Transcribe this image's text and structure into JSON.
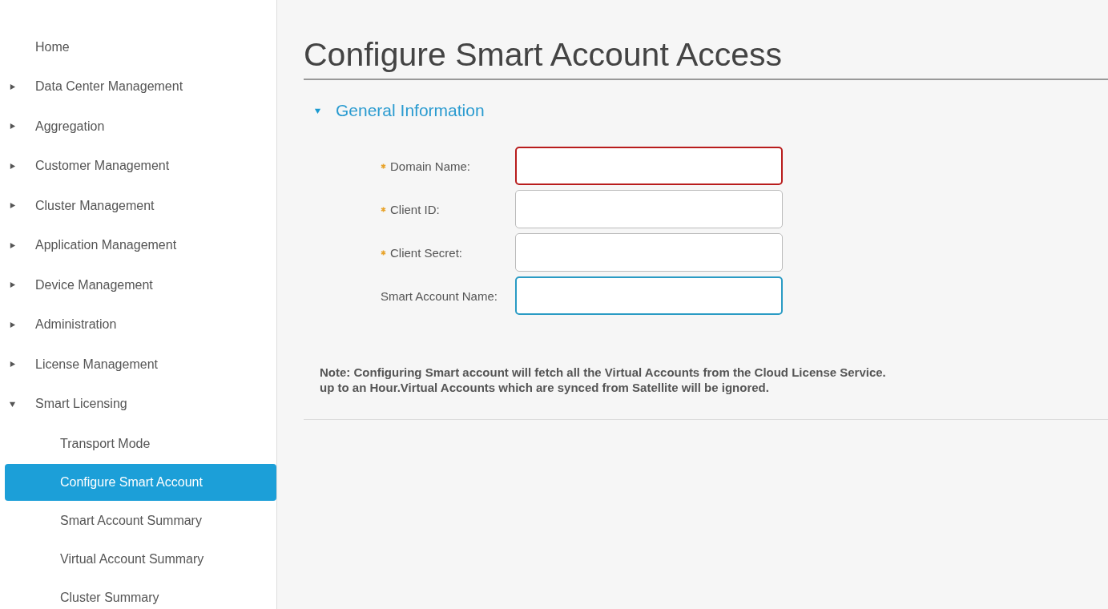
{
  "sidebar": {
    "items": [
      {
        "label": "Home"
      },
      {
        "label": "Data Center Management",
        "expanded": false
      },
      {
        "label": "Aggregation",
        "expanded": false
      },
      {
        "label": "Customer Management",
        "expanded": false
      },
      {
        "label": "Cluster Management",
        "expanded": false
      },
      {
        "label": "Application Management",
        "expanded": false
      },
      {
        "label": "Device Management",
        "expanded": false
      },
      {
        "label": "Administration",
        "expanded": false
      },
      {
        "label": "License Management",
        "expanded": false
      },
      {
        "label": "Smart Licensing",
        "expanded": true,
        "children": [
          {
            "label": "Transport Mode",
            "selected": false
          },
          {
            "label": "Configure Smart Account",
            "selected": true
          },
          {
            "label": "Smart Account Summary",
            "selected": false
          },
          {
            "label": "Virtual Account Summary",
            "selected": false
          },
          {
            "label": "Cluster Summary",
            "selected": false
          }
        ]
      }
    ]
  },
  "page": {
    "title": "Configure Smart Account Access",
    "section": {
      "title": "General Information",
      "expanded": true,
      "fields": [
        {
          "label": "Domain Name:",
          "required": true,
          "invalid": true,
          "focused": false
        },
        {
          "label": "Client ID:",
          "required": true,
          "invalid": false,
          "focused": false
        },
        {
          "label": "Client Secret:",
          "required": true,
          "invalid": false,
          "focused": false
        },
        {
          "label": "Smart Account Name:",
          "required": false,
          "invalid": false,
          "focused": true
        }
      ]
    },
    "note": [
      "Note: Configuring Smart account will fetch all the Virtual Accounts from the Cloud License Service.",
      "up to an Hour.Virtual Accounts which are synced from Satellite will be ignored."
    ]
  }
}
